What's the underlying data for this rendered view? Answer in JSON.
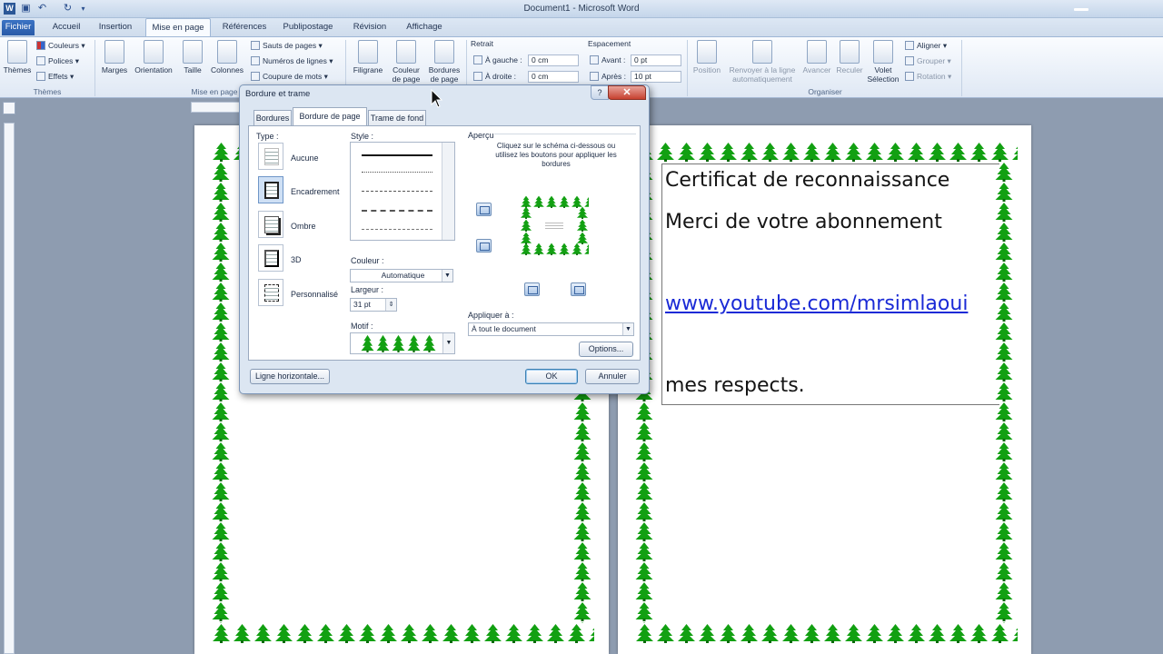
{
  "window": {
    "title": "Document1 - Microsoft Word"
  },
  "tabs": [
    "Fichier",
    "Accueil",
    "Insertion",
    "Mise en page",
    "Références",
    "Publipostage",
    "Révision",
    "Affichage"
  ],
  "ribbon": {
    "themes": {
      "button": "Thèmes",
      "colors": "Couleurs",
      "fonts": "Polices",
      "effects": "Effets",
      "group": "Thèmes"
    },
    "page_setup": {
      "margins": "Marges",
      "orientation": "Orientation",
      "size": "Taille",
      "columns": "Colonnes",
      "breaks": "Sauts de pages",
      "line_numbers": "Numéros de lignes",
      "hyphenation": "Coupure de mots",
      "group": "Mise en page"
    },
    "background": {
      "watermark": "Filigrane",
      "page_color": "Couleur de page",
      "page_borders": "Bordures de page"
    },
    "paragraph": {
      "indent_title": "Retrait",
      "left_label": "À gauche :",
      "left_value": "0 cm",
      "right_label": "À droite :",
      "right_value": "0 cm",
      "spacing_title": "Espacement",
      "before_label": "Avant :",
      "before_value": "0 pt",
      "after_label": "Après :",
      "after_value": "10 pt"
    },
    "arrange": {
      "position": "Position",
      "wrap": "Renvoyer à la ligne automatiquement",
      "forward": "Avancer",
      "backward": "Reculer",
      "pane": "Volet Sélection",
      "align": "Aligner",
      "group_cmd": "Grouper",
      "rotate": "Rotation",
      "group": "Organiser"
    }
  },
  "document": {
    "line1": "Certificat de reconnaissance",
    "line2": "Merci de votre abonnement",
    "link": "www.youtube.com/mrsimlaoui",
    "closing": "mes respects."
  },
  "dialog": {
    "title": "Bordure et trame",
    "tabs": [
      "Bordures",
      "Bordure de page",
      "Trame de fond"
    ],
    "type_label": "Type :",
    "types": [
      "Aucune",
      "Encadrement",
      "Ombre",
      "3D",
      "Personnalisé"
    ],
    "style_label": "Style :",
    "color_label": "Couleur :",
    "color_value": "Automatique",
    "width_label": "Largeur :",
    "width_value": "31 pt",
    "art_label": "Motif :",
    "preview_title": "Aperçu",
    "preview_help": "Cliquez sur le schéma ci-dessous ou utilisez les boutons pour appliquer les bordures",
    "apply_label": "Appliquer à :",
    "apply_value": "À tout le document",
    "options": "Options...",
    "horizontal_line": "Ligne horizontale...",
    "ok": "OK",
    "cancel": "Annuler"
  }
}
